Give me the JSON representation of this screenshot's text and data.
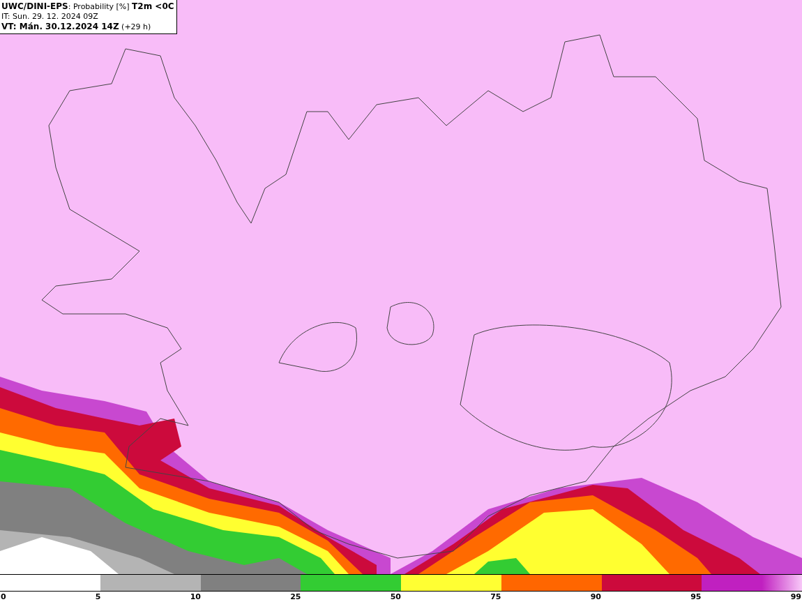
{
  "header": {
    "title": "**UWC/DINI-EPS**: Probability [%] **T2m <0C**",
    "issued": "IT: Sun. 29. 12. 2024 09Z",
    "valid": "**VT: Mán. 30.12.2024 14Z** (+29 h)"
  },
  "legend": {
    "segments": [
      {
        "color": "#b4b4b4"
      },
      {
        "color": "#808080"
      },
      {
        "color": "#33cc33"
      },
      {
        "color": "#ffff33"
      },
      {
        "color": "#ff6600"
      },
      {
        "color": "#cc0a3c"
      },
      {
        "color": "#c020c0"
      }
    ],
    "labels": [
      "0",
      "5",
      "10",
      "25",
      "50",
      "75",
      "90",
      "95",
      "99"
    ]
  }
}
